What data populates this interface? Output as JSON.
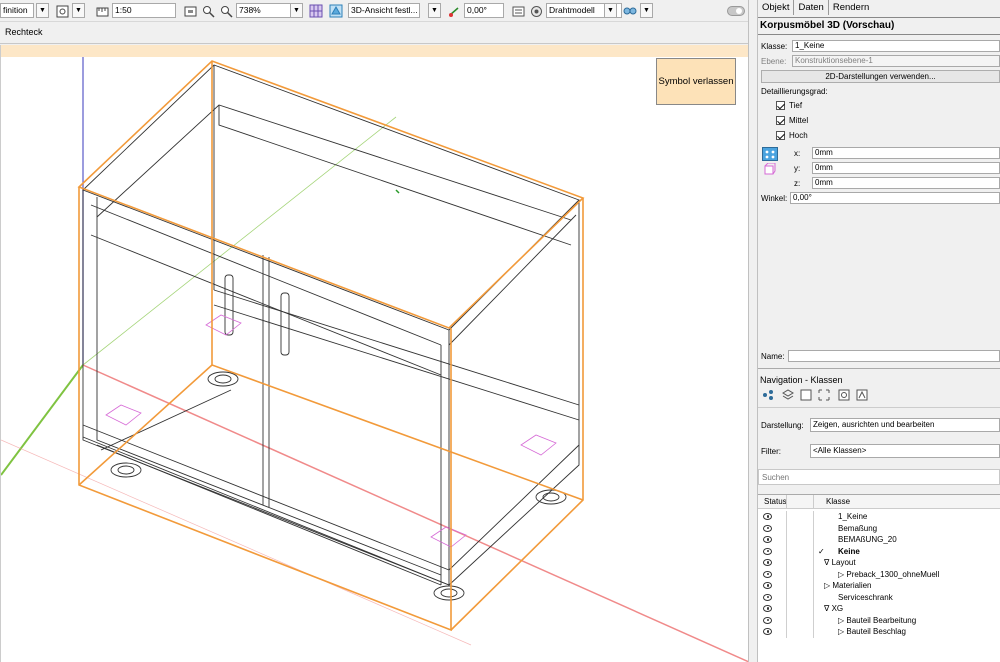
{
  "toolbar1": {
    "definition_text": "finition",
    "scale_value": "1:50",
    "zoom_value": "738%",
    "view_value": "3D-Ansicht festl...",
    "angle_value": "0,00°",
    "render_value": "Drahtmodell"
  },
  "toolbar2": {
    "mode_label": "Rechteck"
  },
  "viewport": {
    "symbol_button_label": "Symbol verlassen"
  },
  "panel": {
    "tabs": [
      "Objekt",
      "Daten",
      "Rendern"
    ],
    "object_title": "Korpusmöbel 3D (Vorschau)",
    "class_label": "Klasse:",
    "class_value": "1_Keine",
    "layer_label": "Ebene:",
    "layer_value": "Konstruktionsebene-1",
    "use_2d_button": "2D-Darstellungen verwenden...",
    "detail_label": "Detaillierungsgrad:",
    "detail_options": [
      "Tief",
      "Mittel",
      "Hoch"
    ],
    "x_label": "x:",
    "x_value": "0mm",
    "y_label": "y:",
    "y_value": "0mm",
    "z_label": "z:",
    "z_value": "0mm",
    "angle_label": "Winkel:",
    "angle_value": "0,00°",
    "name_label": "Name:",
    "name_value": ""
  },
  "navigation": {
    "title": "Navigation - Klassen",
    "display_label": "Darstellung:",
    "display_value": "Zeigen, ausrichten und bearbeiten",
    "filter_label": "Filter:",
    "filter_value": "<Alle Klassen>",
    "search_placeholder": "Suchen",
    "col_status": "Status",
    "col_class": "Klasse",
    "rows": [
      {
        "label": "1_Keine",
        "bold": false,
        "check": false,
        "prefix": ""
      },
      {
        "label": "Bemaßung",
        "bold": false,
        "check": false,
        "prefix": ""
      },
      {
        "label": "BEMAßUNG_20",
        "bold": false,
        "check": false,
        "prefix": ""
      },
      {
        "label": "Keine",
        "bold": true,
        "check": true,
        "prefix": ""
      },
      {
        "label": "Layout",
        "bold": false,
        "check": false,
        "prefix": "∇"
      },
      {
        "label": "Preback_1300_ohneMuell",
        "bold": false,
        "check": false,
        "prefix": "▷"
      },
      {
        "label": "Materialien",
        "bold": false,
        "check": false,
        "prefix": "▷"
      },
      {
        "label": "Serviceschrank",
        "bold": false,
        "check": false,
        "prefix": ""
      },
      {
        "label": "XG",
        "bold": false,
        "check": false,
        "prefix": "∇"
      },
      {
        "label": "Bauteil Bearbeitung",
        "bold": false,
        "check": false,
        "prefix": "▷"
      },
      {
        "label": "Bauteil Beschlag",
        "bold": false,
        "check": false,
        "prefix": "▷"
      }
    ]
  },
  "colors": {
    "selection_orange": "#f29a3a",
    "symbol_button_bg": "#fde2b8",
    "view_bar_bg": "#fde7c7",
    "axis_green": "#7fc341",
    "axis_red": "#f08a8a",
    "axis_blue": "#6666cc"
  }
}
